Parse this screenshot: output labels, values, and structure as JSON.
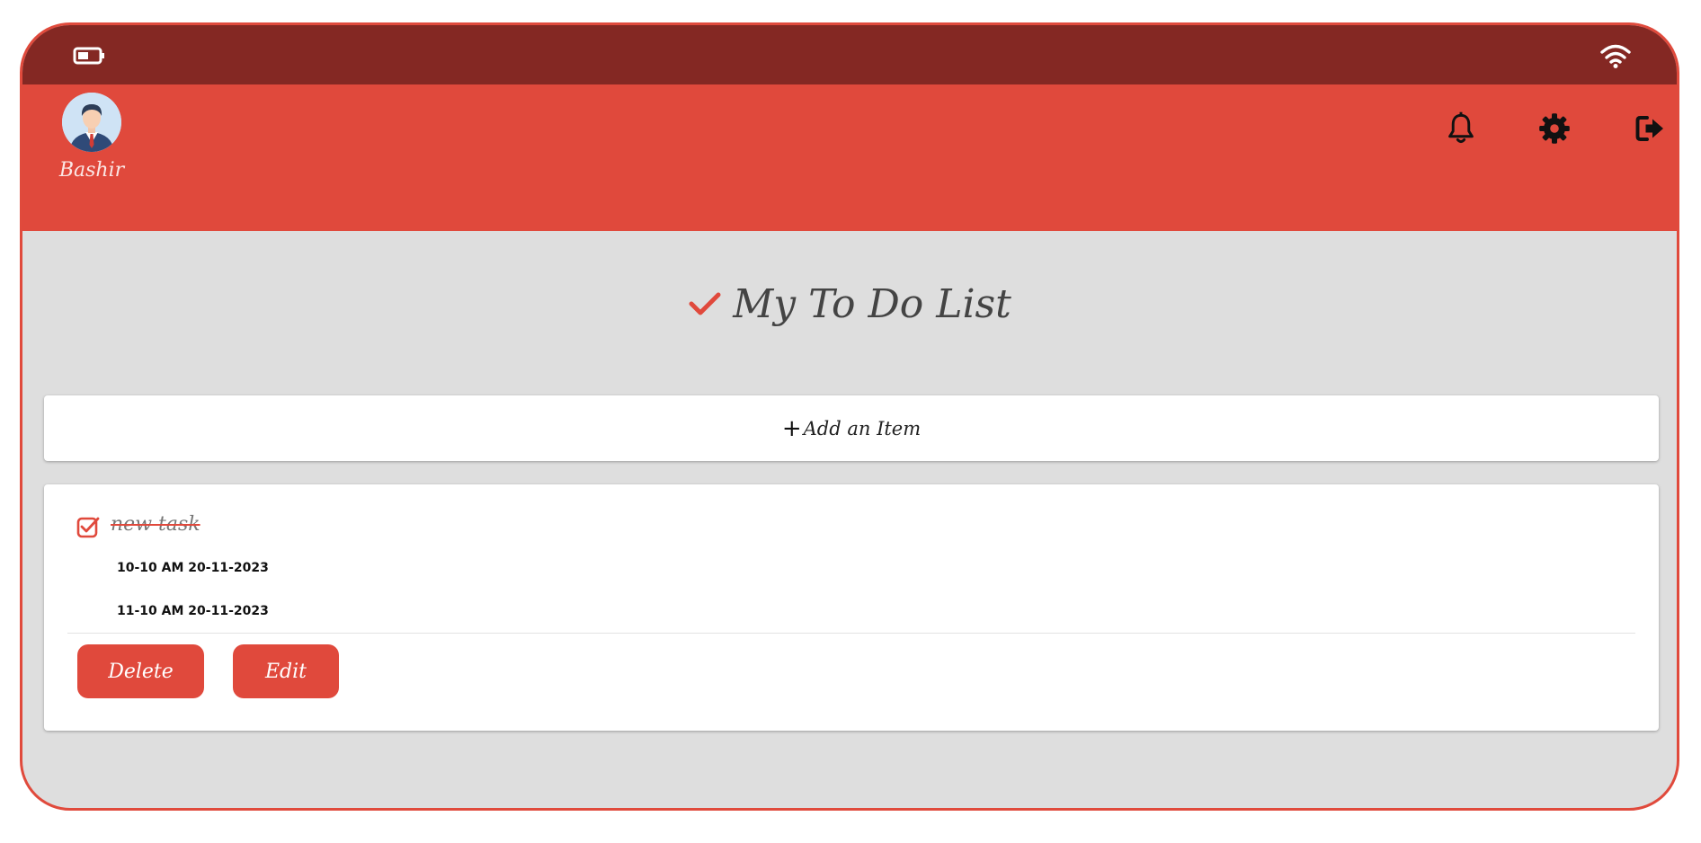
{
  "user": {
    "name": "Bashir"
  },
  "header": {
    "icons": [
      "bell-icon",
      "gear-icon",
      "logout-icon"
    ]
  },
  "page": {
    "title": "My To Do List"
  },
  "add_item": {
    "plus": "+",
    "label": "Add an Item"
  },
  "tasks": [
    {
      "name": "new task",
      "completed": true,
      "start_time": "10-10 AM 20-11-2023",
      "end_time": "11-10 AM 20-11-2023",
      "delete_label": "Delete",
      "edit_label": "Edit"
    }
  ],
  "colors": {
    "accent": "#e0493c",
    "status_bar": "#842823",
    "background": "#dedede"
  }
}
